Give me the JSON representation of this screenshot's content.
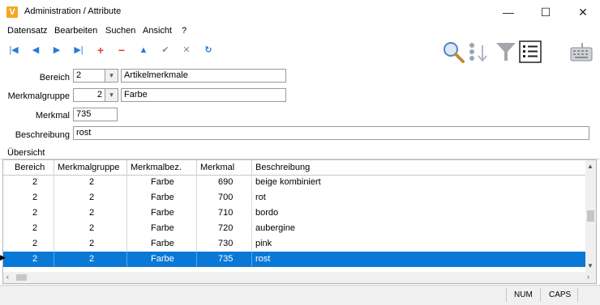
{
  "window": {
    "app_icon_letter": "V",
    "title": "Administration / Attribute",
    "minimize": "—",
    "maximize": "☐",
    "close": "✕"
  },
  "menu": [
    "Datensatz",
    "Bearbeiten",
    "Suchen",
    "Ansicht",
    "?"
  ],
  "toolbar": {
    "first": "|◀",
    "prev": "◀",
    "next": "▶",
    "last": "▶|",
    "add": "+",
    "remove": "−",
    "up": "▲",
    "confirm": "✔",
    "cancel": "✕",
    "refresh": "↻"
  },
  "form": {
    "bereich_label": "Bereich",
    "bereich_value": "2",
    "bereich_text": "Artikelmerkmale",
    "merkmalgruppe_label": "Merkmalgruppe",
    "merkmalgruppe_value": "2",
    "merkmalgruppe_text": "Farbe",
    "merkmal_label": "Merkmal",
    "merkmal_value": "735",
    "beschreibung_label": "Beschreibung",
    "beschreibung_value": "rost"
  },
  "overview": {
    "label": "Übersicht",
    "columns": [
      "Bereich",
      "Merkmalgruppe",
      "Merkmalbez.",
      "Merkmal",
      "Beschreibung"
    ],
    "rows": [
      {
        "bereich": "2",
        "gruppe": "2",
        "bez": "Farbe",
        "merkmal": "690",
        "beschreibung": "beige kombiniert"
      },
      {
        "bereich": "2",
        "gruppe": "2",
        "bez": "Farbe",
        "merkmal": "700",
        "beschreibung": "rot"
      },
      {
        "bereich": "2",
        "gruppe": "2",
        "bez": "Farbe",
        "merkmal": "710",
        "beschreibung": "bordo"
      },
      {
        "bereich": "2",
        "gruppe": "2",
        "bez": "Farbe",
        "merkmal": "720",
        "beschreibung": "aubergine"
      },
      {
        "bereich": "2",
        "gruppe": "2",
        "bez": "Farbe",
        "merkmal": "730",
        "beschreibung": "pink"
      },
      {
        "bereich": "2",
        "gruppe": "2",
        "bez": "Farbe",
        "merkmal": "735",
        "beschreibung": "rost"
      }
    ],
    "selected_index": 5
  },
  "status": {
    "num": "NUM",
    "caps": "CAPS"
  },
  "colors": {
    "selection": "#0a79d6",
    "nav_blue": "#2a7ad4",
    "add_red": "#d9462a",
    "app_icon": "#f5a623"
  }
}
